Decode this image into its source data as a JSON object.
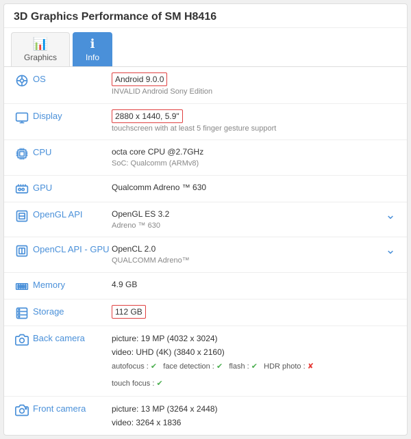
{
  "page": {
    "title": "3D Graphics Performance of SM H8416"
  },
  "tabs": [
    {
      "id": "graphics",
      "label": "Graphics",
      "icon": "📊",
      "active": false
    },
    {
      "id": "info",
      "label": "Info",
      "icon": "ℹ",
      "active": true
    }
  ],
  "rows": [
    {
      "id": "os",
      "label": "OS",
      "icon": "os",
      "value_highlight": "Android 9.0.0",
      "value_sub": "INVALID Android Sony Edition",
      "highlighted": true
    },
    {
      "id": "display",
      "label": "Display",
      "icon": "display",
      "value_highlight": "2880 x 1440, 5.9\"",
      "value_sub": "touchscreen with at least 5 finger gesture support",
      "highlighted": true
    },
    {
      "id": "cpu",
      "label": "CPU",
      "icon": "cpu",
      "value_main": "octa core CPU @2.7GHz",
      "value_sub": "SoC: Qualcomm (ARMv8)",
      "highlighted": false
    },
    {
      "id": "gpu",
      "label": "GPU",
      "icon": "gpu",
      "value_main": "Qualcomm Adreno ™ 630",
      "highlighted": false
    },
    {
      "id": "opengl",
      "label": "OpenGL API",
      "icon": "opengl",
      "value_main": "OpenGL ES 3.2",
      "value_sub": "Adreno ™ 630",
      "has_action": true,
      "highlighted": false
    },
    {
      "id": "opencl",
      "label": "OpenCL API - GPU",
      "icon": "opencl",
      "value_main": "OpenCL 2.0",
      "value_sub": "QUALCOMM Adreno™",
      "has_action": true,
      "highlighted": false
    },
    {
      "id": "memory",
      "label": "Memory",
      "icon": "memory",
      "value_main": "4.9 GB",
      "highlighted": false
    },
    {
      "id": "storage",
      "label": "Storage",
      "icon": "storage",
      "value_highlight": "112 GB",
      "highlighted": true
    },
    {
      "id": "back_camera",
      "label": "Back camera",
      "icon": "camera",
      "value_picture": "picture: 19 MP (4032 x 3024)",
      "value_video": "video: UHD (4K) (3840 x 2160)",
      "features": [
        {
          "name": "autofocus",
          "status": "check"
        },
        {
          "name": "face detection",
          "status": "check"
        },
        {
          "name": "flash",
          "status": "check"
        },
        {
          "name": "HDR photo",
          "status": "cross"
        }
      ],
      "features2": [
        {
          "name": "touch focus",
          "status": "check"
        }
      ],
      "highlighted": false
    },
    {
      "id": "front_camera",
      "label": "Front camera",
      "icon": "front_camera",
      "value_picture": "picture: 13 MP (3264 x 2448)",
      "value_video": "video: 3264 x 1836",
      "highlighted": false
    }
  ]
}
